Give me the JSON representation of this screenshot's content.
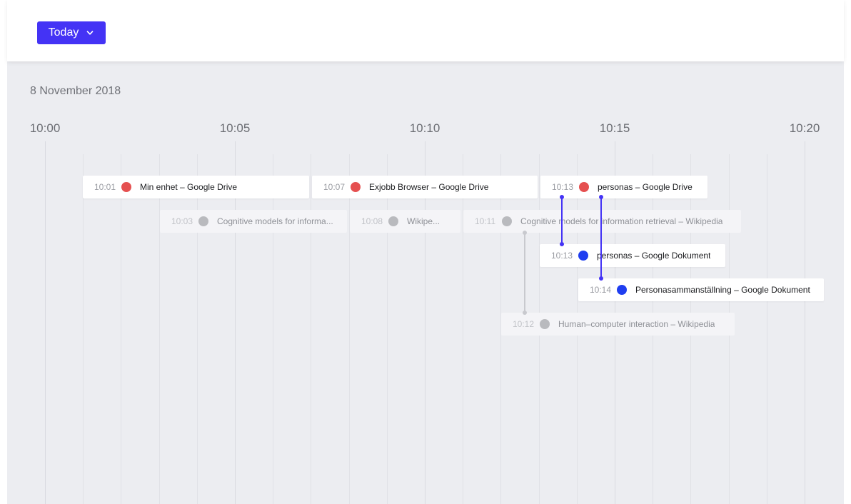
{
  "header": {
    "today_label": "Today"
  },
  "timeline": {
    "date": "8 November 2018",
    "ticks": [
      "10:00",
      "10:05",
      "10:10",
      "10:15",
      "10:20"
    ]
  },
  "colors": {
    "accent": "#4433f5",
    "drive_dot": "#e55050",
    "docs_dot": "#1f3ef0",
    "faded_dot": "#b9babe",
    "connector_active": "#4433f5",
    "connector_faded": "#c8c9ce"
  },
  "events": [
    {
      "time": "10:01",
      "title": "Min enhet – Google Drive"
    },
    {
      "time": "10:07",
      "title": "Exjobb Browser – Google Drive"
    },
    {
      "time": "10:13",
      "title": "personas – Google Drive"
    },
    {
      "time": "10:03",
      "title": "Cognitive models for informa..."
    },
    {
      "time": "10:08",
      "title": "Wikipe..."
    },
    {
      "time": "10:11",
      "title": "Cognitive models for information retrieval – Wikipedia"
    },
    {
      "time": "10:13",
      "title": "personas – Google Dokument"
    },
    {
      "time": "10:14",
      "title": "Personasammanställning – Google Dokument"
    },
    {
      "time": "10:12",
      "title": "Human–computer interaction – Wikipedia"
    }
  ]
}
